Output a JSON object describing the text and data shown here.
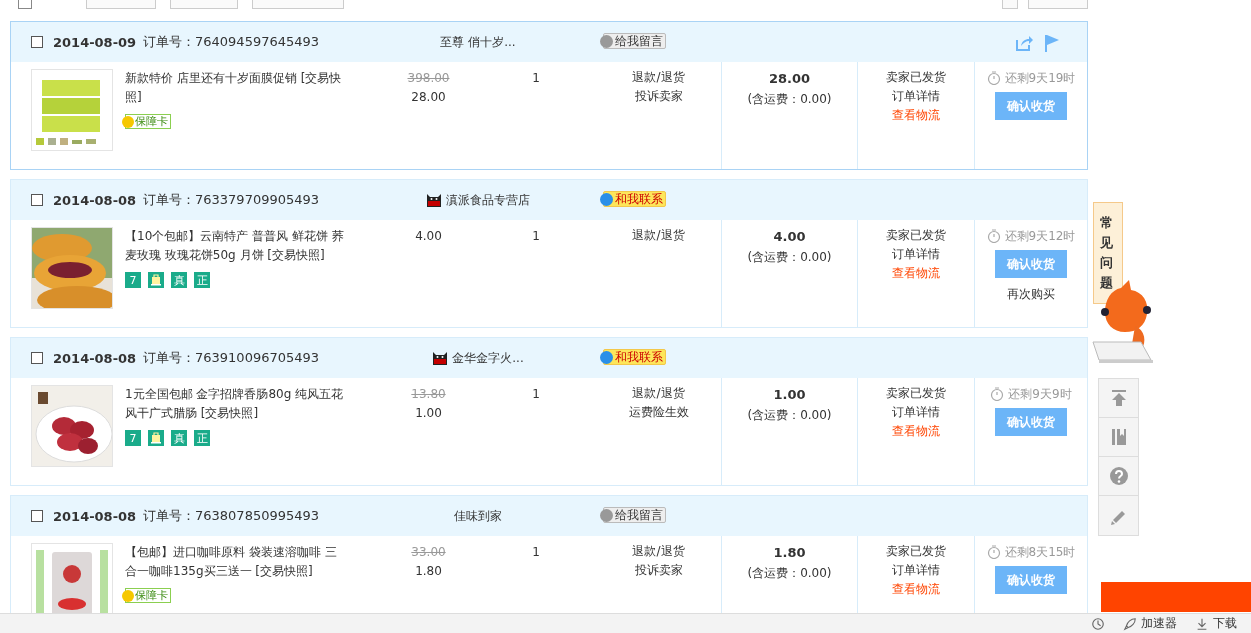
{
  "select_all": {
    "checked": false
  },
  "orders": [
    {
      "hovered": true,
      "checked": false,
      "date": "2014-08-09",
      "order_no": "订单号：764094597645493",
      "shop": {
        "name": "至尊 俏十岁...",
        "tmall": false
      },
      "contact": {
        "kind": "message",
        "label": "给我留言"
      },
      "item": {
        "title": "新款特价 店里还有十岁面膜促销 [交易快照]",
        "tags": [
          {
            "kind": "card",
            "label": "保障卡"
          }
        ]
      },
      "price": {
        "original": "398.00",
        "current": "28.00"
      },
      "qty": "1",
      "actions": [
        "退款/退货",
        "投诉卖家"
      ],
      "total": "28.00",
      "shipping": "(含运费：0.00)",
      "status": [
        "卖家已发货",
        "订单详情"
      ],
      "logistics": "查看物流",
      "countdown": "还剩9天19时",
      "confirm": "确认收货"
    },
    {
      "hovered": false,
      "checked": false,
      "date": "2014-08-08",
      "order_no": "订单号：763379709905493",
      "shop": {
        "name": "滇派食品专营店",
        "tmall": true
      },
      "contact": {
        "kind": "contact",
        "label": "和我联系"
      },
      "item": {
        "title": "【10个包邮】云南特产 普普风 鲜花饼 荞麦玫瑰 玫瑰花饼50g 月饼 [交易快照]",
        "tags": [
          {
            "kind": "text",
            "label": "7"
          },
          {
            "kind": "icon"
          },
          {
            "kind": "text",
            "label": "真"
          },
          {
            "kind": "text",
            "label": "正"
          }
        ]
      },
      "price": {
        "current": "4.00"
      },
      "qty": "1",
      "actions": [
        "退款/退货"
      ],
      "total": "4.00",
      "shipping": "(含运费：0.00)",
      "status": [
        "卖家已发货",
        "订单详情"
      ],
      "logistics": "查看物流",
      "countdown": "还剩9天12时",
      "confirm": "确认收货",
      "extra": "再次购买"
    },
    {
      "hovered": false,
      "checked": false,
      "date": "2014-08-08",
      "order_no": "订单号：763910096705493",
      "shop": {
        "name": "金华金字火...",
        "tmall": true
      },
      "contact": {
        "kind": "contact",
        "label": "和我联系"
      },
      "item": {
        "title": "1元全国包邮 金字招牌香肠80g 纯风五花风干广式腊肠 [交易快照]",
        "tags": [
          {
            "kind": "text",
            "label": "7"
          },
          {
            "kind": "icon"
          },
          {
            "kind": "text",
            "label": "真"
          },
          {
            "kind": "text",
            "label": "正"
          }
        ]
      },
      "price": {
        "original": "13.80",
        "current": "1.00"
      },
      "qty": "1",
      "actions": [
        "退款/退货",
        "运费险生效"
      ],
      "total": "1.00",
      "shipping": "(含运费：0.00)",
      "status": [
        "卖家已发货",
        "订单详情"
      ],
      "logistics": "查看物流",
      "countdown": "还剩9天9时",
      "confirm": "确认收货"
    },
    {
      "hovered": false,
      "checked": false,
      "date": "2014-08-08",
      "order_no": "订单号：763807850995493",
      "shop": {
        "name": "佳味到家",
        "tmall": false
      },
      "contact": {
        "kind": "message",
        "label": "给我留言"
      },
      "item": {
        "title": "【包邮】进口咖啡原料 袋装速溶咖啡 三合一咖啡135g买三送一 [交易快照]",
        "tags": [
          {
            "kind": "card",
            "label": "保障卡"
          }
        ]
      },
      "price": {
        "original": "33.00",
        "current": "1.80"
      },
      "qty": "1",
      "actions": [
        "退款/退货",
        "投诉卖家"
      ],
      "total": "1.80",
      "shipping": "(含运费：0.00)",
      "status": [
        "卖家已发货",
        "订单详情"
      ],
      "logistics": "查看物流",
      "countdown": "还剩8天15时",
      "confirm": "确认收货"
    }
  ],
  "sidebar": {
    "faq": "常见问题"
  },
  "status_bar": {
    "items": [
      "加速器",
      "下载"
    ]
  }
}
